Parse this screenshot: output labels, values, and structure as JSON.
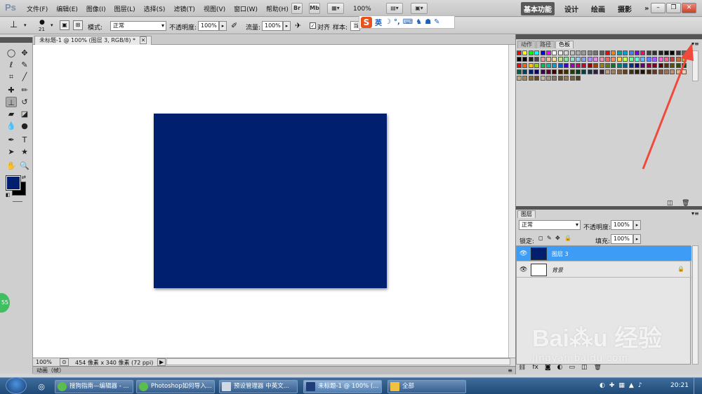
{
  "app": {
    "logo": "Ps"
  },
  "menu": [
    "文件(F)",
    "编辑(E)",
    "图像(I)",
    "图层(L)",
    "选择(S)",
    "滤镜(T)",
    "视图(V)",
    "窗口(W)",
    "帮助(H)"
  ],
  "menubar_buttons": {
    "br": "Br",
    "mb": "Mb",
    "zoom": "100%"
  },
  "workspace": {
    "items": [
      "基本功能",
      "设计",
      "绘画",
      "摄影"
    ],
    "more": "»"
  },
  "window_controls": {
    "min": "–",
    "restore": "❐",
    "close": "✕"
  },
  "ime": {
    "logo": "S",
    "lang": "英"
  },
  "options": {
    "brush_size": "21",
    "mode_label": "模式:",
    "mode_value": "正常",
    "opacity_label": "不透明度:",
    "opacity_value": "100%",
    "flow_label": "流量:",
    "flow_value": "100%",
    "align_label": "对齐",
    "sample_label": "样本:",
    "sample_value": "当前"
  },
  "document": {
    "tab_title": "未标题-1 @ 100% (图层 3, RGB/8) *",
    "zoom": "100%",
    "size_info": "454 像素 x 340 像素 (72 ppi)",
    "canvas_color": "#001f6e"
  },
  "animation_panel": {
    "label": "动画（帧）"
  },
  "swatch_panel": {
    "tabs": [
      "动作",
      "路径",
      "色板"
    ]
  },
  "layers_panel": {
    "tab": "图层",
    "blend_mode": "正常",
    "opacity_label": "不透明度:",
    "opacity_value": "100%",
    "lock_label": "锁定:",
    "fill_label": "填充:",
    "fill_value": "100%",
    "layers": [
      {
        "name": "图层 3",
        "selected": true,
        "thumb": "#001f6e"
      },
      {
        "name": "背景",
        "selected": false,
        "thumb": "#ffffff",
        "locked": true
      }
    ]
  },
  "side_badge": "55",
  "taskbar": {
    "tasks": [
      "搜狗指南—编辑器 - ...",
      "Photoshop如何导入...",
      "预设管理器 中英文...",
      "未标题-1 @ 100% (...",
      "全部"
    ],
    "time": "20:21"
  }
}
